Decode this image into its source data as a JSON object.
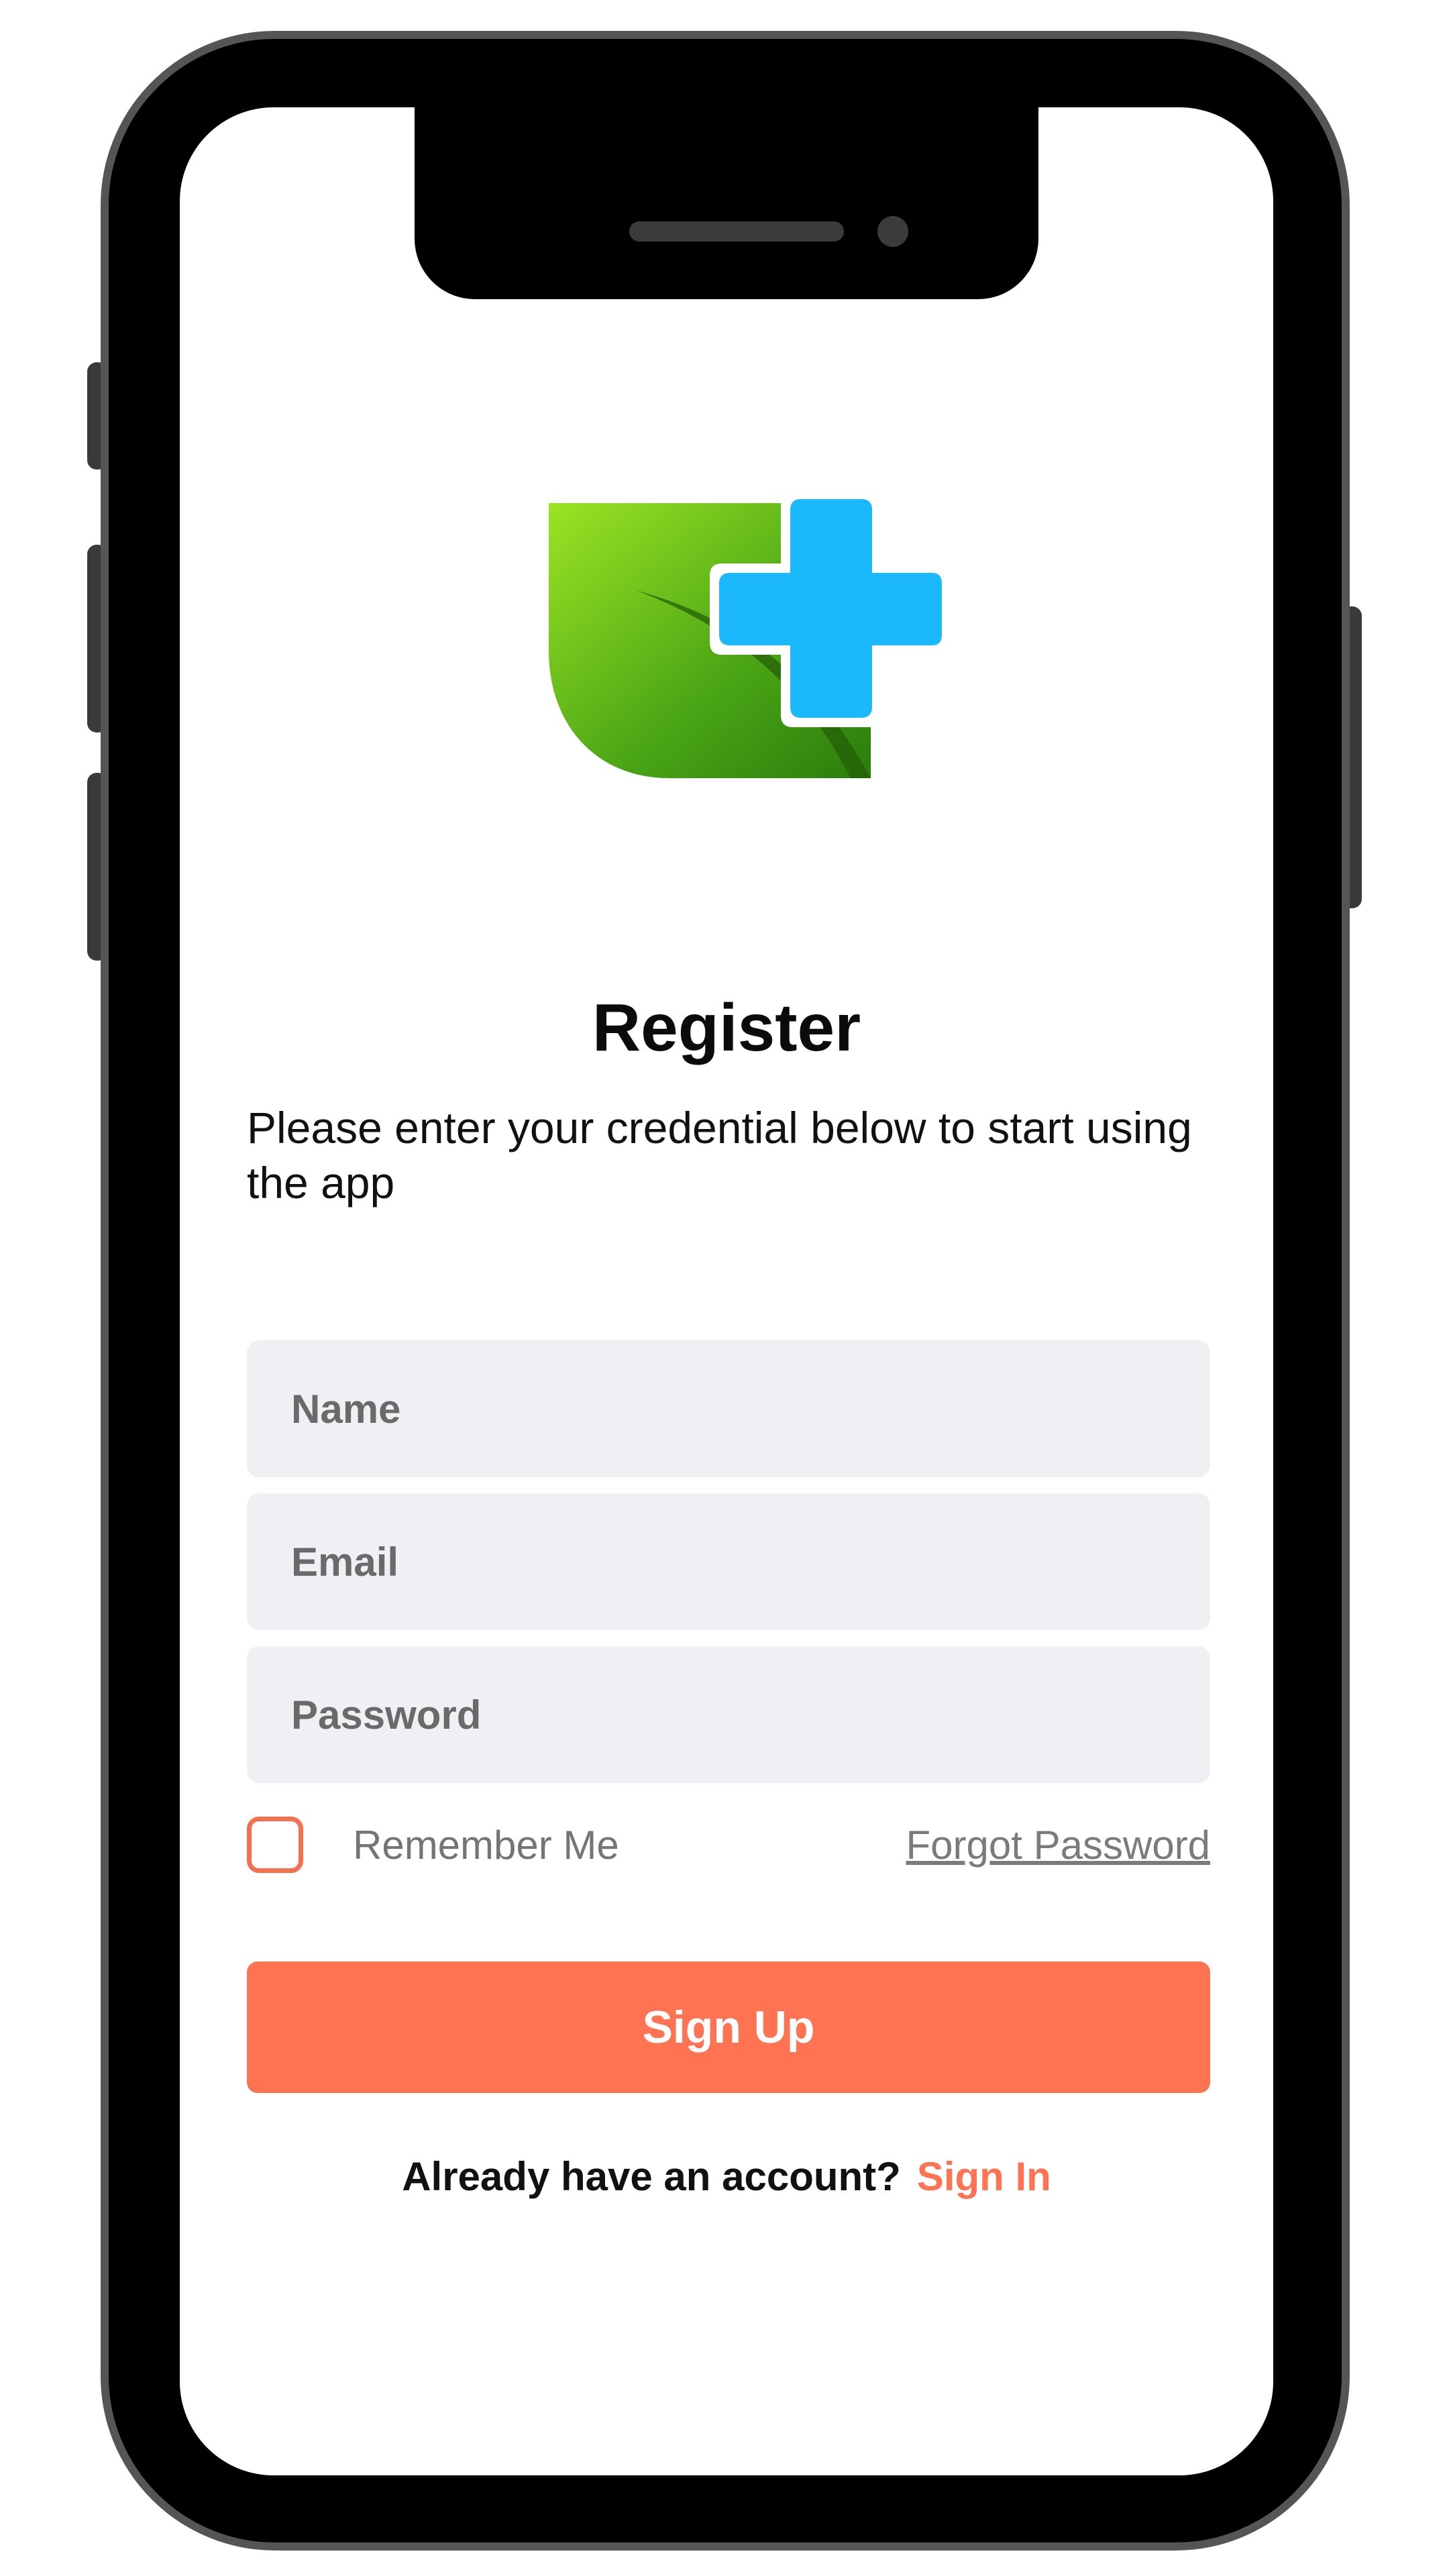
{
  "screen": {
    "title": "Register",
    "subtitle": "Please enter your credential below to start using the app"
  },
  "form": {
    "name_placeholder": "Name",
    "email_placeholder": "Email",
    "password_placeholder": "Password",
    "remember_label": "Remember Me",
    "remember_checked": false,
    "forgot_label": "Forgot Password",
    "submit_label": "Sign Up"
  },
  "footer": {
    "question": "Already have an account?",
    "link_label": "Sign In"
  },
  "icons": {
    "logo": "leaf-plus-logo-icon"
  },
  "colors": {
    "accent": "#fe7452",
    "field_background": "#eff0f4",
    "logo_green": "#5bb516",
    "logo_blue": "#1bb8fb"
  }
}
